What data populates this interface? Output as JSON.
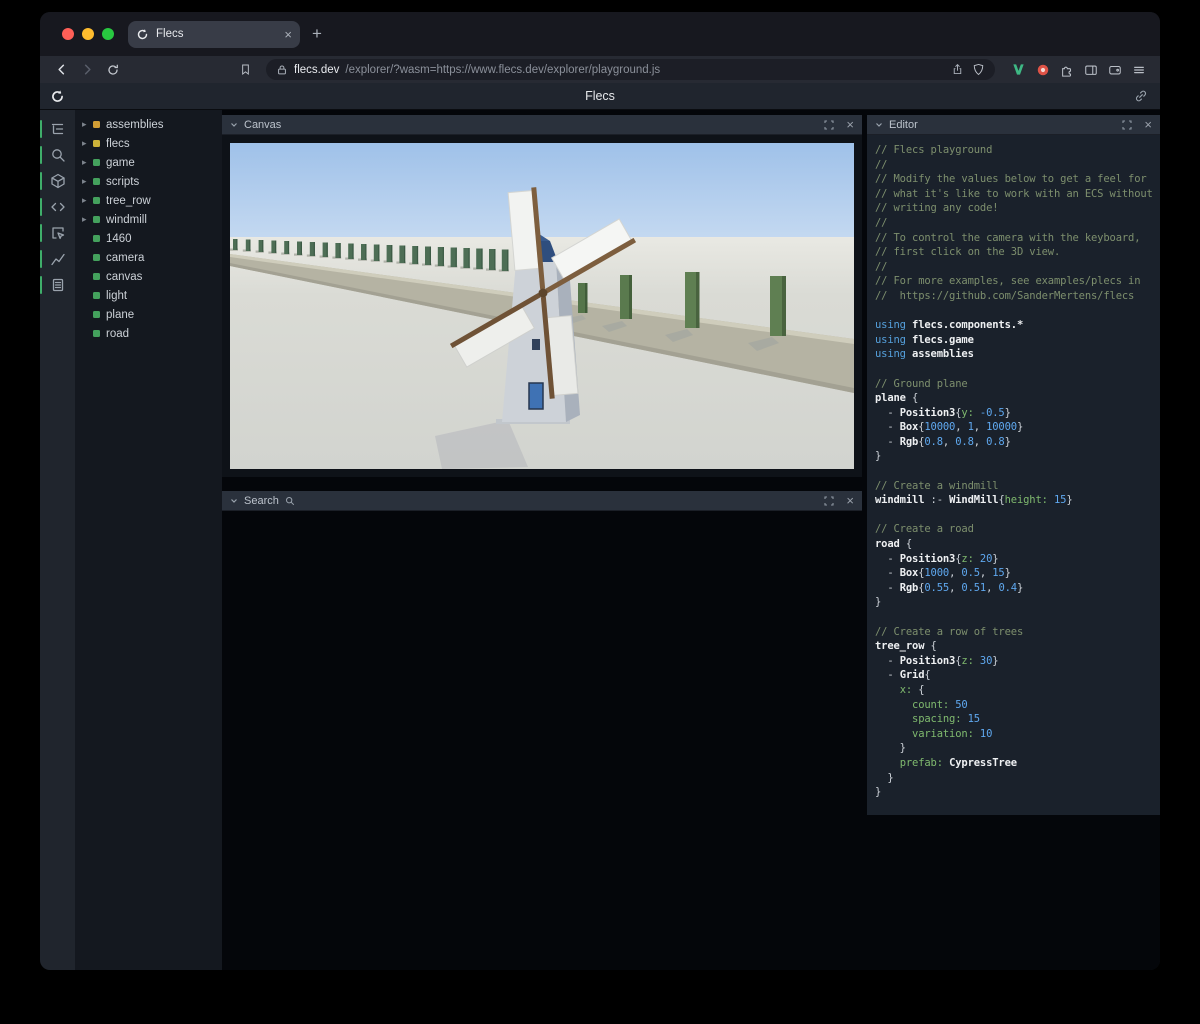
{
  "browser": {
    "traffic_lights": [
      "#ff5f57",
      "#febc2e",
      "#28c840"
    ],
    "tab": {
      "title": "Flecs",
      "close_label": "×"
    },
    "new_tab_label": "+",
    "url": {
      "domain": "flecs.dev",
      "path": "/explorer/?wasm=https://www.flecs.dev/explorer/playground.js"
    }
  },
  "app": {
    "title": "Flecs",
    "accent_color": "#3fae6a"
  },
  "sidebar": {
    "icons": [
      "entity-tree-icon",
      "search-icon",
      "cube-icon",
      "code-icon",
      "inspect-icon",
      "chart-icon",
      "memory-icon"
    ]
  },
  "tree": {
    "items": [
      {
        "label": "assemblies",
        "color": "#d29e35",
        "expandable": true
      },
      {
        "label": "flecs",
        "color": "#ccb23a",
        "expandable": true
      },
      {
        "label": "game",
        "color": "#44a15d",
        "expandable": true
      },
      {
        "label": "scripts",
        "color": "#44a15d",
        "expandable": true
      },
      {
        "label": "tree_row",
        "color": "#44a15d",
        "expandable": true
      },
      {
        "label": "windmill",
        "color": "#44a15d",
        "expandable": true
      },
      {
        "label": "1460",
        "color": "#44a15d",
        "expandable": false
      },
      {
        "label": "camera",
        "color": "#44a15d",
        "expandable": false
      },
      {
        "label": "canvas",
        "color": "#44a15d",
        "expandable": false
      },
      {
        "label": "light",
        "color": "#44a15d",
        "expandable": false
      },
      {
        "label": "plane",
        "color": "#44a15d",
        "expandable": false
      },
      {
        "label": "road",
        "color": "#44a15d",
        "expandable": false
      }
    ]
  },
  "panels": {
    "canvas": {
      "title": "Canvas",
      "close_label": "×"
    },
    "search": {
      "title": "Search",
      "close_label": "×"
    },
    "editor": {
      "title": "Editor",
      "close_label": "×"
    }
  },
  "editor": {
    "lines": [
      [
        {
          "c": "com",
          "t": "// Flecs playground"
        }
      ],
      [
        {
          "c": "com",
          "t": "//"
        }
      ],
      [
        {
          "c": "com",
          "t": "// Modify the values below to get a feel for"
        }
      ],
      [
        {
          "c": "com",
          "t": "// what it's like to work with an ECS without"
        }
      ],
      [
        {
          "c": "com",
          "t": "// writing any code!"
        }
      ],
      [
        {
          "c": "com",
          "t": "//"
        }
      ],
      [
        {
          "c": "com",
          "t": "// To control the camera with the keyboard,"
        }
      ],
      [
        {
          "c": "com",
          "t": "// first click on the 3D view."
        }
      ],
      [
        {
          "c": "com",
          "t": "//"
        }
      ],
      [
        {
          "c": "com",
          "t": "// For more examples, see examples/plecs in"
        }
      ],
      [
        {
          "c": "com",
          "t": "//  https://github.com/SanderMertens/flecs"
        }
      ],
      [],
      [
        {
          "c": "kw",
          "t": "using"
        },
        {
          "c": "pl",
          "t": " "
        },
        {
          "c": "id",
          "t": "flecs.components.*"
        }
      ],
      [
        {
          "c": "kw",
          "t": "using"
        },
        {
          "c": "pl",
          "t": " "
        },
        {
          "c": "id",
          "t": "flecs.game"
        }
      ],
      [
        {
          "c": "kw",
          "t": "using"
        },
        {
          "c": "pl",
          "t": " "
        },
        {
          "c": "id",
          "t": "assemblies"
        }
      ],
      [],
      [
        {
          "c": "com",
          "t": "// Ground plane"
        }
      ],
      [
        {
          "c": "id",
          "t": "plane"
        },
        {
          "c": "pl",
          "t": " {"
        }
      ],
      [
        {
          "c": "pl",
          "t": "  - "
        },
        {
          "c": "id",
          "t": "Position3"
        },
        {
          "c": "pl",
          "t": "{"
        },
        {
          "c": "key",
          "t": "y:"
        },
        {
          "c": "pl",
          "t": " "
        },
        {
          "c": "num",
          "t": "-0.5"
        },
        {
          "c": "pl",
          "t": "}"
        }
      ],
      [
        {
          "c": "pl",
          "t": "  - "
        },
        {
          "c": "id",
          "t": "Box"
        },
        {
          "c": "pl",
          "t": "{"
        },
        {
          "c": "num",
          "t": "10000"
        },
        {
          "c": "pl",
          "t": ", "
        },
        {
          "c": "num",
          "t": "1"
        },
        {
          "c": "pl",
          "t": ", "
        },
        {
          "c": "num",
          "t": "10000"
        },
        {
          "c": "pl",
          "t": "}"
        }
      ],
      [
        {
          "c": "pl",
          "t": "  - "
        },
        {
          "c": "id",
          "t": "Rgb"
        },
        {
          "c": "pl",
          "t": "{"
        },
        {
          "c": "num",
          "t": "0.8"
        },
        {
          "c": "pl",
          "t": ", "
        },
        {
          "c": "num",
          "t": "0.8"
        },
        {
          "c": "pl",
          "t": ", "
        },
        {
          "c": "num",
          "t": "0.8"
        },
        {
          "c": "pl",
          "t": "}"
        }
      ],
      [
        {
          "c": "pl",
          "t": "}"
        }
      ],
      [],
      [
        {
          "c": "com",
          "t": "// Create a windmill"
        }
      ],
      [
        {
          "c": "id",
          "t": "windmill"
        },
        {
          "c": "pl",
          "t": " :- "
        },
        {
          "c": "id",
          "t": "WindMill"
        },
        {
          "c": "pl",
          "t": "{"
        },
        {
          "c": "key",
          "t": "height:"
        },
        {
          "c": "pl",
          "t": " "
        },
        {
          "c": "num",
          "t": "15"
        },
        {
          "c": "pl",
          "t": "}"
        }
      ],
      [],
      [
        {
          "c": "com",
          "t": "// Create a road"
        }
      ],
      [
        {
          "c": "id",
          "t": "road"
        },
        {
          "c": "pl",
          "t": " {"
        }
      ],
      [
        {
          "c": "pl",
          "t": "  - "
        },
        {
          "c": "id",
          "t": "Position3"
        },
        {
          "c": "pl",
          "t": "{"
        },
        {
          "c": "key",
          "t": "z:"
        },
        {
          "c": "pl",
          "t": " "
        },
        {
          "c": "num",
          "t": "20"
        },
        {
          "c": "pl",
          "t": "}"
        }
      ],
      [
        {
          "c": "pl",
          "t": "  - "
        },
        {
          "c": "id",
          "t": "Box"
        },
        {
          "c": "pl",
          "t": "{"
        },
        {
          "c": "num",
          "t": "1000"
        },
        {
          "c": "pl",
          "t": ", "
        },
        {
          "c": "num",
          "t": "0.5"
        },
        {
          "c": "pl",
          "t": ", "
        },
        {
          "c": "num",
          "t": "15"
        },
        {
          "c": "pl",
          "t": "}"
        }
      ],
      [
        {
          "c": "pl",
          "t": "  - "
        },
        {
          "c": "id",
          "t": "Rgb"
        },
        {
          "c": "pl",
          "t": "{"
        },
        {
          "c": "num",
          "t": "0.55"
        },
        {
          "c": "pl",
          "t": ", "
        },
        {
          "c": "num",
          "t": "0.51"
        },
        {
          "c": "pl",
          "t": ", "
        },
        {
          "c": "num",
          "t": "0.4"
        },
        {
          "c": "pl",
          "t": "}"
        }
      ],
      [
        {
          "c": "pl",
          "t": "}"
        }
      ],
      [],
      [
        {
          "c": "com",
          "t": "// Create a row of trees"
        }
      ],
      [
        {
          "c": "id",
          "t": "tree_row"
        },
        {
          "c": "pl",
          "t": " {"
        }
      ],
      [
        {
          "c": "pl",
          "t": "  - "
        },
        {
          "c": "id",
          "t": "Position3"
        },
        {
          "c": "pl",
          "t": "{"
        },
        {
          "c": "key",
          "t": "z:"
        },
        {
          "c": "pl",
          "t": " "
        },
        {
          "c": "num",
          "t": "30"
        },
        {
          "c": "pl",
          "t": "}"
        }
      ],
      [
        {
          "c": "pl",
          "t": "  - "
        },
        {
          "c": "id",
          "t": "Grid"
        },
        {
          "c": "pl",
          "t": "{"
        }
      ],
      [
        {
          "c": "pl",
          "t": "    "
        },
        {
          "c": "key",
          "t": "x:"
        },
        {
          "c": "pl",
          "t": " {"
        }
      ],
      [
        {
          "c": "pl",
          "t": "      "
        },
        {
          "c": "key",
          "t": "count:"
        },
        {
          "c": "pl",
          "t": " "
        },
        {
          "c": "num",
          "t": "50"
        }
      ],
      [
        {
          "c": "pl",
          "t": "      "
        },
        {
          "c": "key",
          "t": "spacing:"
        },
        {
          "c": "pl",
          "t": " "
        },
        {
          "c": "num",
          "t": "15"
        }
      ],
      [
        {
          "c": "pl",
          "t": "      "
        },
        {
          "c": "key",
          "t": "variation:"
        },
        {
          "c": "pl",
          "t": " "
        },
        {
          "c": "num",
          "t": "10"
        }
      ],
      [
        {
          "c": "pl",
          "t": "    }"
        }
      ],
      [
        {
          "c": "pl",
          "t": "    "
        },
        {
          "c": "key",
          "t": "prefab:"
        },
        {
          "c": "pl",
          "t": " "
        },
        {
          "c": "id",
          "t": "CypressTree"
        }
      ],
      [
        {
          "c": "pl",
          "t": "  }"
        }
      ],
      [
        {
          "c": "pl",
          "t": "}"
        }
      ]
    ]
  }
}
